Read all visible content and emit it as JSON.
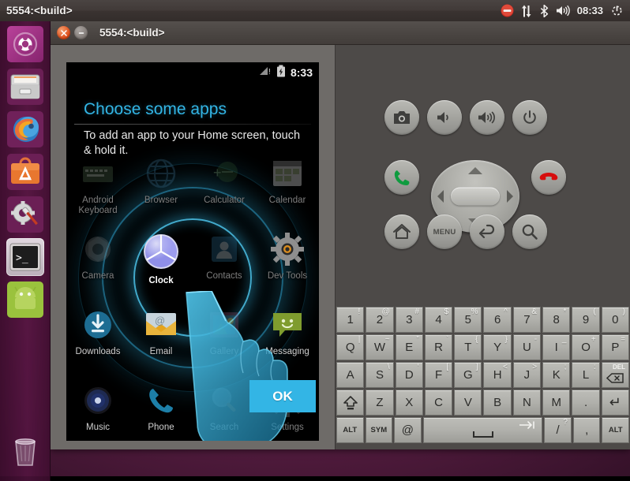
{
  "top_panel": {
    "title": "5554:<build>",
    "tray": {
      "dnd_icon": "do-not-disturb-icon",
      "network_icon": "network-updown-icon",
      "bluetooth_icon": "bluetooth-icon",
      "volume_icon": "volume-icon",
      "clock": "08:33",
      "session_icon": "session-power-icon"
    }
  },
  "launcher": {
    "items": [
      {
        "name": "ubuntu-dash",
        "label": "Ubuntu Dash",
        "icon": "ubuntu-logo-icon"
      },
      {
        "name": "files",
        "label": "Files",
        "icon": "file-manager-icon"
      },
      {
        "name": "firefox",
        "label": "Firefox Web Browser",
        "icon": "firefox-icon"
      },
      {
        "name": "software-center",
        "label": "Ubuntu Software Center",
        "icon": "software-center-icon"
      },
      {
        "name": "system-settings",
        "label": "System Settings",
        "icon": "gear-wrench-icon"
      },
      {
        "name": "terminal",
        "label": "Terminal",
        "icon": "terminal-icon"
      },
      {
        "name": "android-emulator",
        "label": "Android Emulator",
        "icon": "android-icon"
      }
    ],
    "trash": {
      "label": "Trash",
      "icon": "trash-icon"
    }
  },
  "emulator_window": {
    "title": "5554:<build>",
    "close_label": "x",
    "minimize_label": "–"
  },
  "device": {
    "status_bar": {
      "signal_icon": "signal-no-service-icon",
      "battery_icon": "battery-charging-icon",
      "time": "8:33"
    },
    "hint_title": "Choose some apps",
    "hint_body": "To add an app to your Home screen, touch & hold it.",
    "ok_button": "OK",
    "apps": [
      {
        "label": "Android Keyboard",
        "icon": "android-keyboard-icon",
        "state": "dim"
      },
      {
        "label": "Browser",
        "icon": "browser-globe-icon",
        "state": "dim"
      },
      {
        "label": "Calculator",
        "icon": "calculator-icon",
        "state": "dim"
      },
      {
        "label": "Calendar",
        "icon": "calendar-icon",
        "state": "dim"
      },
      {
        "label": "Camera",
        "icon": "camera-icon",
        "state": "dim"
      },
      {
        "label": "Clock",
        "icon": "clock-icon",
        "state": "highlighted"
      },
      {
        "label": "Contacts",
        "icon": "contacts-icon",
        "state": "dim"
      },
      {
        "label": "Dev Tools",
        "icon": "dev-tools-gear-icon",
        "state": "dim"
      },
      {
        "label": "Downloads",
        "icon": "downloads-icon",
        "state": "normal"
      },
      {
        "label": "Email",
        "icon": "email-icon",
        "state": "normal"
      },
      {
        "label": "Gallery",
        "icon": "gallery-icon",
        "state": "dim"
      },
      {
        "label": "Messaging",
        "icon": "messaging-icon",
        "state": "normal"
      },
      {
        "label": "Music",
        "icon": "music-icon",
        "state": "normal"
      },
      {
        "label": "Phone",
        "icon": "phone-icon",
        "state": "normal"
      },
      {
        "label": "Search",
        "icon": "search-icon",
        "state": "dim"
      },
      {
        "label": "Settings",
        "icon": "settings-gear-icon",
        "state": "dim"
      }
    ]
  },
  "controls": {
    "buttons": [
      {
        "name": "screenshot-button",
        "icon": "camera-icon"
      },
      {
        "name": "volume-down-button",
        "icon": "volume-down-icon"
      },
      {
        "name": "volume-up-button",
        "icon": "volume-up-icon"
      },
      {
        "name": "power-button",
        "icon": "power-icon"
      },
      {
        "name": "call-button",
        "icon": "phone-green-icon"
      },
      {
        "name": "hangup-button",
        "icon": "phone-red-icon"
      },
      {
        "name": "home-button",
        "icon": "home-icon"
      },
      {
        "name": "menu-button",
        "icon": "menu-icon",
        "label": "MENU"
      },
      {
        "name": "back-button",
        "icon": "back-arrow-icon"
      },
      {
        "name": "search-button",
        "icon": "magnifier-icon"
      }
    ],
    "dpad": {
      "name": "dpad",
      "up": "dpad-up",
      "down": "dpad-down",
      "left": "dpad-left",
      "right": "dpad-right",
      "center": "dpad-center"
    }
  },
  "keyboard": {
    "rows": [
      [
        {
          "main": "1",
          "sup": "!"
        },
        {
          "main": "2",
          "sup": "@"
        },
        {
          "main": "3",
          "sup": "#"
        },
        {
          "main": "4",
          "sup": "$"
        },
        {
          "main": "5",
          "sup": "%"
        },
        {
          "main": "6",
          "sup": "^"
        },
        {
          "main": "7",
          "sup": "&"
        },
        {
          "main": "8",
          "sup": "*"
        },
        {
          "main": "9",
          "sup": "("
        },
        {
          "main": "0",
          "sup": ")"
        }
      ],
      [
        {
          "main": "Q",
          "sup": "|"
        },
        {
          "main": "W",
          "sup": "~"
        },
        {
          "main": "E",
          "sup": "”"
        },
        {
          "main": "R",
          "sup": "`"
        },
        {
          "main": "T",
          "sup": "{"
        },
        {
          "main": "Y",
          "sup": "}"
        },
        {
          "main": "U",
          "sup": "-"
        },
        {
          "main": "I",
          "sup": "_"
        },
        {
          "main": "O",
          "sup": "+"
        },
        {
          "main": "P",
          "sup": "="
        }
      ],
      [
        {
          "main": "A",
          "sup": ""
        },
        {
          "main": "S",
          "sup": "\\"
        },
        {
          "main": "D",
          "sup": "‘"
        },
        {
          "main": "F",
          "sup": "["
        },
        {
          "main": "G",
          "sup": "]"
        },
        {
          "main": "H",
          "sup": "<"
        },
        {
          "main": "J",
          "sup": ">"
        },
        {
          "main": "K",
          "sup": ";"
        },
        {
          "main": "L",
          "sup": ":"
        },
        {
          "main": "DEL",
          "sup": "",
          "type": "del"
        }
      ],
      [
        {
          "main": "",
          "sup": "",
          "type": "shift"
        },
        {
          "main": "Z",
          "sup": ""
        },
        {
          "main": "X",
          "sup": ""
        },
        {
          "main": "C",
          "sup": ""
        },
        {
          "main": "V",
          "sup": ""
        },
        {
          "main": "B",
          "sup": ""
        },
        {
          "main": "N",
          "sup": ""
        },
        {
          "main": "M",
          "sup": ""
        },
        {
          "main": ".",
          "sup": ""
        },
        {
          "main": "↵",
          "sup": "",
          "type": "enter"
        }
      ],
      [
        {
          "main": "ALT",
          "sup": "",
          "type": "small"
        },
        {
          "main": "SYM",
          "sup": "",
          "type": "small"
        },
        {
          "main": "@",
          "sup": ""
        },
        {
          "main": "",
          "sup": "",
          "type": "space"
        },
        {
          "main": "/",
          "sup": "?"
        },
        {
          "main": ",",
          "sup": ""
        },
        {
          "main": "ALT",
          "sup": "",
          "type": "small"
        }
      ]
    ]
  },
  "colors": {
    "accent_blue": "#33b5e5",
    "ubuntu_orange": "#dd4814",
    "panel_dark": "#3a3331",
    "emulator_gray": "#4d4a48",
    "bezel_gray": "#6e6b68"
  }
}
